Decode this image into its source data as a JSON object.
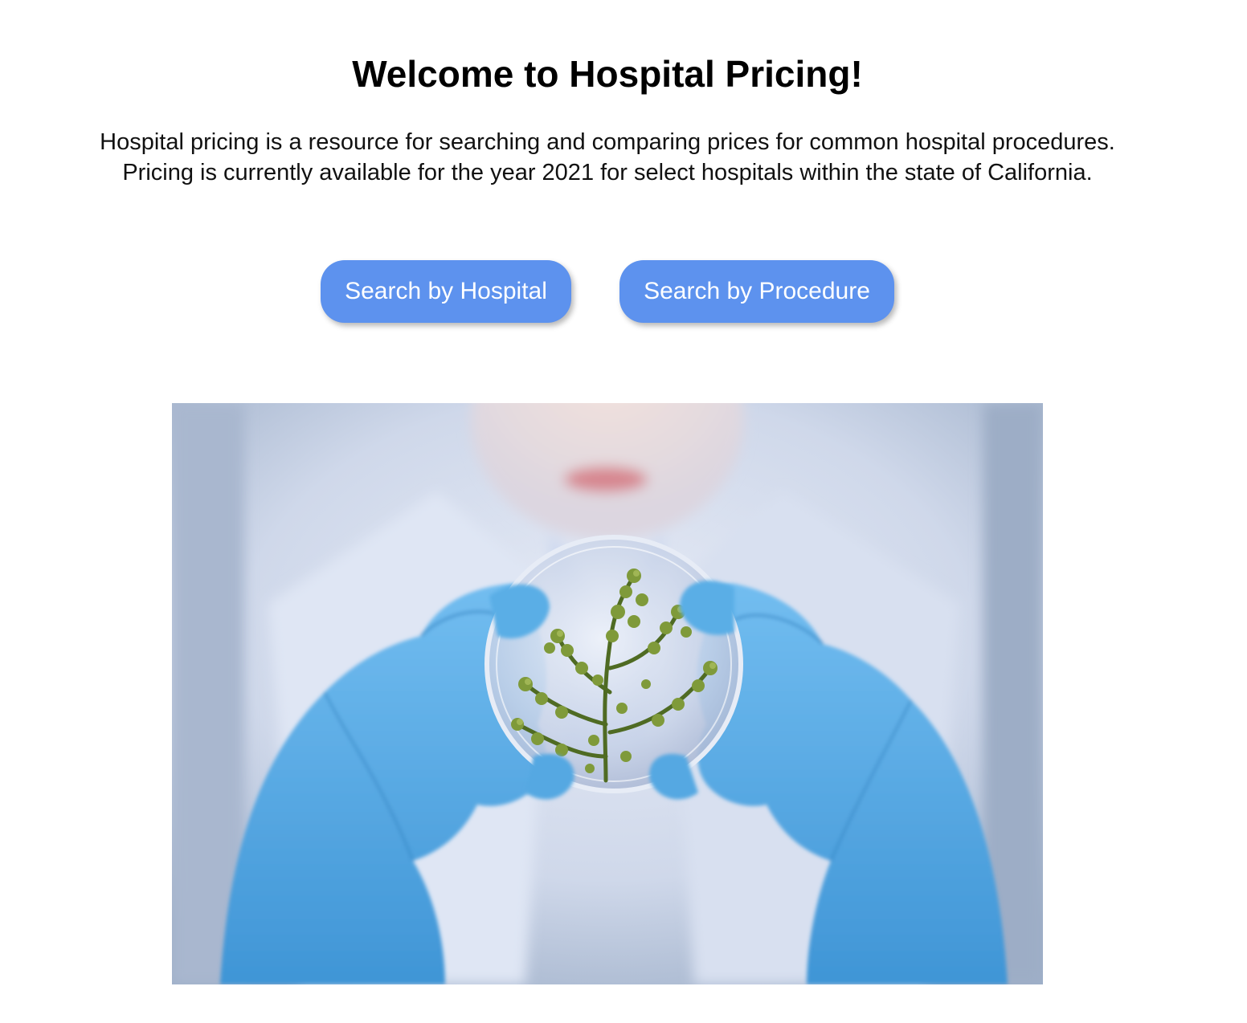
{
  "header": {
    "title": "Welcome to Hospital Pricing!"
  },
  "intro": {
    "line1": "Hospital pricing is a resource for searching and comparing prices for common hospital procedures.",
    "line2": "Pricing is currently available for the year 2021 for select hospitals within the state of California."
  },
  "actions": {
    "search_hospital_label": "Search by Hospital",
    "search_procedure_label": "Search by Procedure"
  },
  "colors": {
    "button_bg": "#5d92ee",
    "button_text": "#ffffff",
    "glove": "#5aaee6",
    "coat": "#d9e1f1"
  },
  "hero": {
    "icon": "scientist-petri-dish-image"
  }
}
